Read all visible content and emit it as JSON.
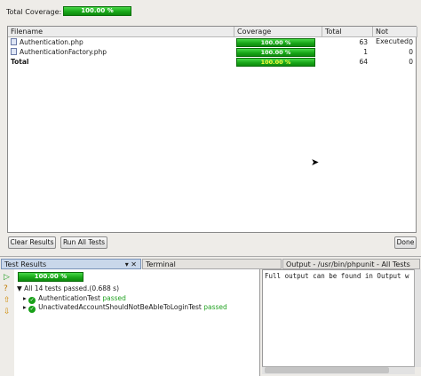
{
  "coverage": {
    "total_label": "Total Coverage:",
    "total_value": "100.00 %"
  },
  "table": {
    "headers": [
      "Filename",
      "Coverage",
      "Total",
      "Not Executed"
    ],
    "rows": [
      {
        "name": "Authentication.php",
        "coverage": "100.00 %",
        "total": "63",
        "not_executed": "0"
      },
      {
        "name": "AuthenticationFactory.php",
        "coverage": "100.00 %",
        "total": "1",
        "not_executed": "0"
      },
      {
        "name": "Total",
        "coverage": "100.00 %",
        "total": "64",
        "not_executed": "0"
      }
    ]
  },
  "buttons": {
    "clear": "Clear Results",
    "run_all": "Run All Tests",
    "done": "Done"
  },
  "tabs": {
    "results": "Test Results",
    "terminal": "Terminal",
    "output": "Output - /usr/bin/phpunit - All Tests"
  },
  "results": {
    "progress": "100.00 %",
    "summary": "All 14 tests passed.(0.688 s)",
    "tests": [
      {
        "name": "AuthenticationTest",
        "status": "passed"
      },
      {
        "name": "UnactivatedAccountShouldNotBeAbleToLoginTest",
        "status": "passed"
      }
    ]
  },
  "output": {
    "text": "Full output can be found in Output w"
  },
  "colors": {
    "bar_green": "#1aa81a",
    "passed_text": "#23a323",
    "active_tab": "#c9d7ea"
  }
}
